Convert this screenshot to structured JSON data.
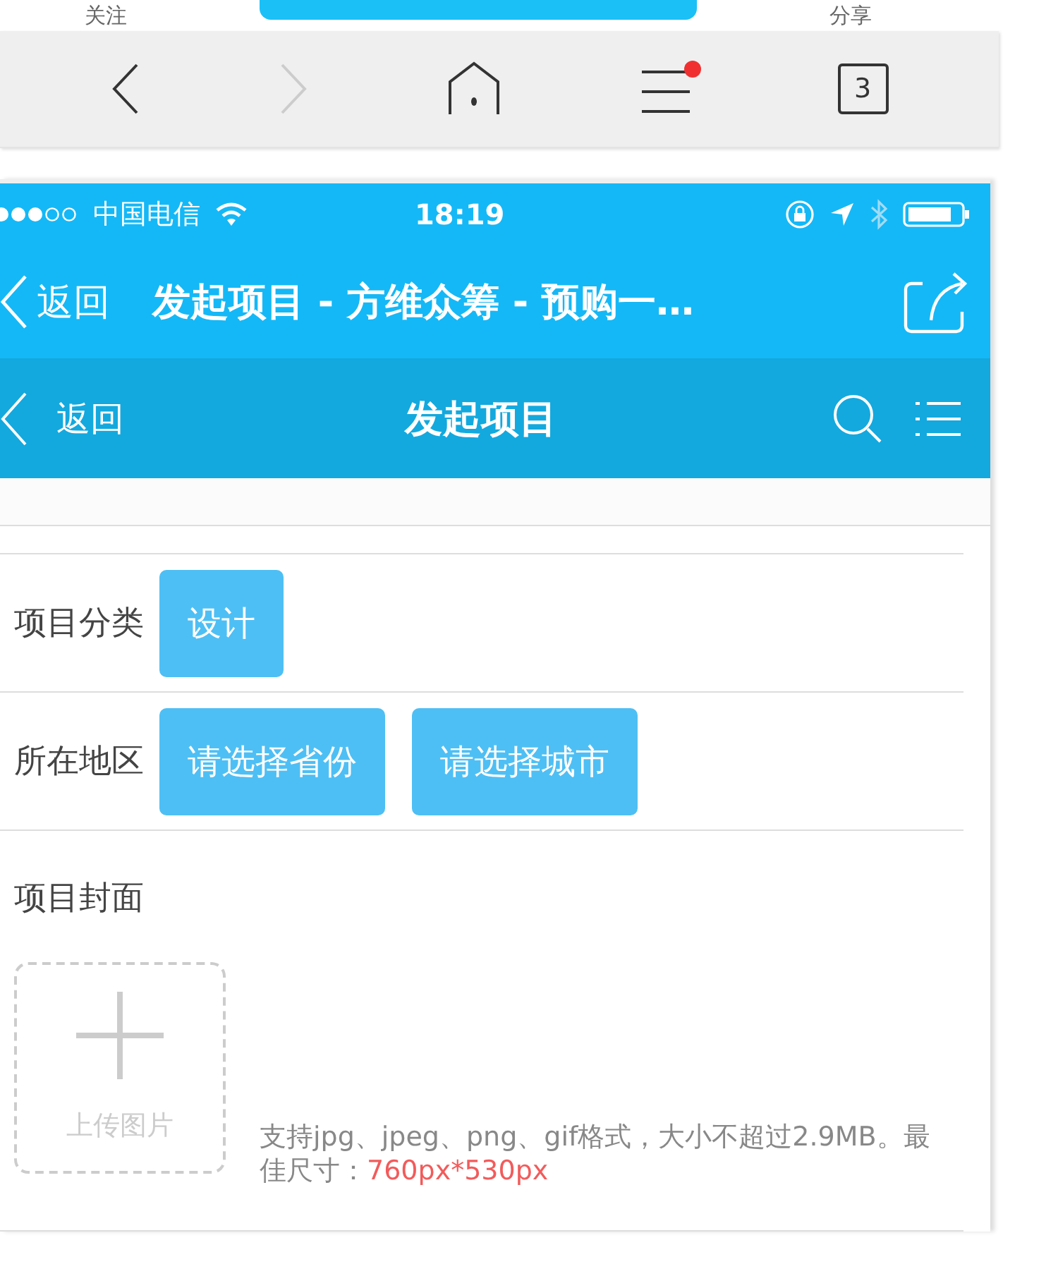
{
  "top_tabs": [
    {
      "label": "关注",
      "selected": false
    },
    {
      "selected": true
    },
    {
      "label": "分享",
      "selected": false
    }
  ],
  "browser_toolbar": {
    "forward_disabled": true,
    "menu_badge": true,
    "tab_count": "3"
  },
  "status_bar": {
    "carrier": "中国电信",
    "time": "18:19"
  },
  "nav_bar": {
    "back": "返回",
    "title": "发起项目 - 方维众筹 - 预购一…"
  },
  "page_header": {
    "back": "返回",
    "title": "发起项目"
  },
  "form": {
    "rows": [
      {
        "label": "项目分类",
        "options": [
          "设计"
        ]
      },
      {
        "label": "所在地区",
        "options": [
          "请选择省份",
          "请选择城市"
        ]
      }
    ],
    "cover": {
      "label": "项目封面",
      "upload": "上传图片",
      "hint": "支持jpg、jpeg、png、gif格式，大小不超过2.9MB。最佳尺寸：**760px*530px**"
    }
  }
}
